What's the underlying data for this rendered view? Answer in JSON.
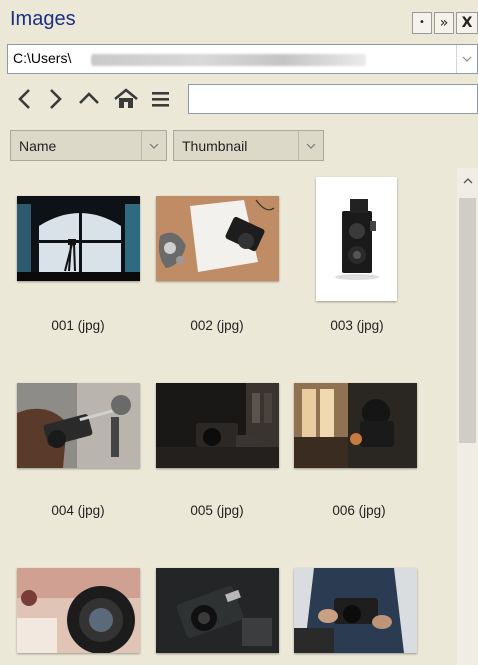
{
  "panel": {
    "title": "Images",
    "pin_glyph": "•",
    "more_glyph": "»",
    "close_glyph": "X"
  },
  "path": {
    "value": "C:\\Users\\",
    "dropdown_icon": "chevron-down-icon"
  },
  "nav": {
    "back_glyph": "❮",
    "forward_glyph": "❯",
    "up_glyph": "⌃",
    "home_glyph": "⌂",
    "menu_glyph": "≡",
    "filter_value": ""
  },
  "sort": {
    "selected": "Name"
  },
  "view": {
    "selected": "Thumbnail"
  },
  "thumbnails": [
    {
      "label": "001 (jpg)"
    },
    {
      "label": "002 (jpg)"
    },
    {
      "label": "003 (jpg)"
    },
    {
      "label": "004 (jpg)"
    },
    {
      "label": "005 (jpg)"
    },
    {
      "label": "006 (jpg)"
    },
    {
      "label": ""
    },
    {
      "label": ""
    },
    {
      "label": ""
    }
  ],
  "scrollbar": {
    "up_glyph": "⌃"
  },
  "colors": {
    "panel_bg": "#ece8d8",
    "title_text": "#1c2f80"
  }
}
